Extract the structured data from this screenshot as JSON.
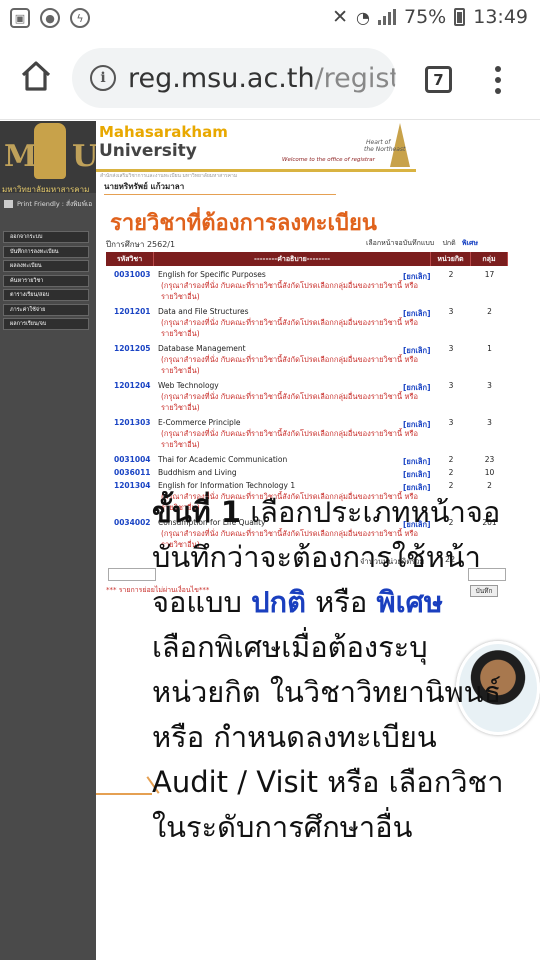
{
  "status_bar": {
    "battery": "75%",
    "time": "13:49"
  },
  "browser": {
    "url_host": "reg.msu.ac.th",
    "url_rest": "/registi",
    "tab_count": "7"
  },
  "site": {
    "logo_letters_left": "M",
    "logo_letters_right": "U",
    "logo_caption": "มหาวิทยาลัยมหาสารคาม",
    "print_friendly": "Print Friendly : สั่งพิมพ์เอ",
    "banner_line1": "Mahasarakham",
    "banner_line2": "University",
    "banner_heart1": "Heart of",
    "banner_heart2": "the Northeast",
    "banner_welcome": "Welcome to the office of registrar",
    "banner_sub": "สำนักส่งเสริมวิชาการและงานทะเบียน มหาวิทยาลัยมหาสารคาม",
    "user_name": "นายหริทรัพย์ แก้วมาลา"
  },
  "sidebar": {
    "items": [
      {
        "label": "ออกจากระบบ"
      },
      {
        "label": "บันทึกการลงทะเบียน"
      },
      {
        "label": "ผลลงทะเบียน"
      },
      {
        "label": "ค้นหารายวิชา"
      },
      {
        "label": "ตารางเรียน/สอบ"
      },
      {
        "label": "ภาระค่าใช้จ่าย"
      },
      {
        "label": "ผลการเรียน/จบ"
      }
    ]
  },
  "main": {
    "title": "รายวิชาที่ต้องการลงทะเบียน",
    "semester": "ปีการศึกษา 2562/1",
    "mode_label": "เลือกหน้าจอบันทึกแบบ",
    "mode_normal": "ปกติ",
    "mode_special": "พิเศษ",
    "table": {
      "headers": [
        "รหัสวิชา",
        "--------คำอธิบาย--------",
        "หน่วยกิต",
        "กลุ่ม"
      ],
      "cancel_label": "[ยกเลิก]",
      "remark": "(กรุณาสำรองที่นั่ง กับคณะที่รายวิชานี้สังกัดโปรดเลือกกลุ่มอื่นของรายวิชานี้ หรือรายวิชาอื่น)",
      "rows": [
        {
          "code": "0031003",
          "name": "English for Specific Purposes",
          "credits": "2",
          "group": "17",
          "has_remark": true
        },
        {
          "code": "1201201",
          "name": "Data and File Structures",
          "credits": "3",
          "group": "2",
          "has_remark": true
        },
        {
          "code": "1201205",
          "name": "Database Management",
          "credits": "3",
          "group": "1",
          "has_remark": true
        },
        {
          "code": "1201204",
          "name": "Web Technology",
          "credits": "3",
          "group": "3",
          "has_remark": true
        },
        {
          "code": "1201303",
          "name": "E-Commerce Principle",
          "credits": "3",
          "group": "3",
          "has_remark": true
        },
        {
          "code": "0031004",
          "name": "Thai for Academic Communication",
          "credits": "2",
          "group": "23",
          "has_remark": false
        },
        {
          "code": "0036011",
          "name": "Buddhism and Living",
          "credits": "2",
          "group": "10",
          "has_remark": false
        },
        {
          "code": "1201304",
          "name": "English for Information Technology 1",
          "credits": "2",
          "group": "2",
          "has_remark": true
        },
        {
          "code": "0034002",
          "name": "Consumption for Life Quality",
          "credits": "2",
          "group": "201",
          "has_remark": true
        }
      ]
    },
    "total_label": "จำนวนหน่วยกิตรวม",
    "total_value": "22",
    "note": "*** รายการย่อยไม่ผ่านเงื่อนไข***",
    "save_label": "บันทึก"
  },
  "tutorial": {
    "step": "ขั้นที่ 1",
    "line1_rest": " เลือกประเภทหน้าจอ",
    "line2": "บันทึกว่าจะต้องการใช้หน้า",
    "line3_a": "จอแบบ ",
    "line3_normal": "ปกติ",
    "line3_b": " หรือ ",
    "line3_special": "พิเศษ",
    "line4": "เลือกพิเศษเมื่อต้องระบุ",
    "line5": "หน่วยกิต ในวิชาวิทยานิพนธ์",
    "line6": "หรือ กำหนดลงทะเบียน",
    "line7": "Audit / Visit หรือ เลือกวิชา",
    "line8": "ในระดับการศึกษาอื่น"
  }
}
